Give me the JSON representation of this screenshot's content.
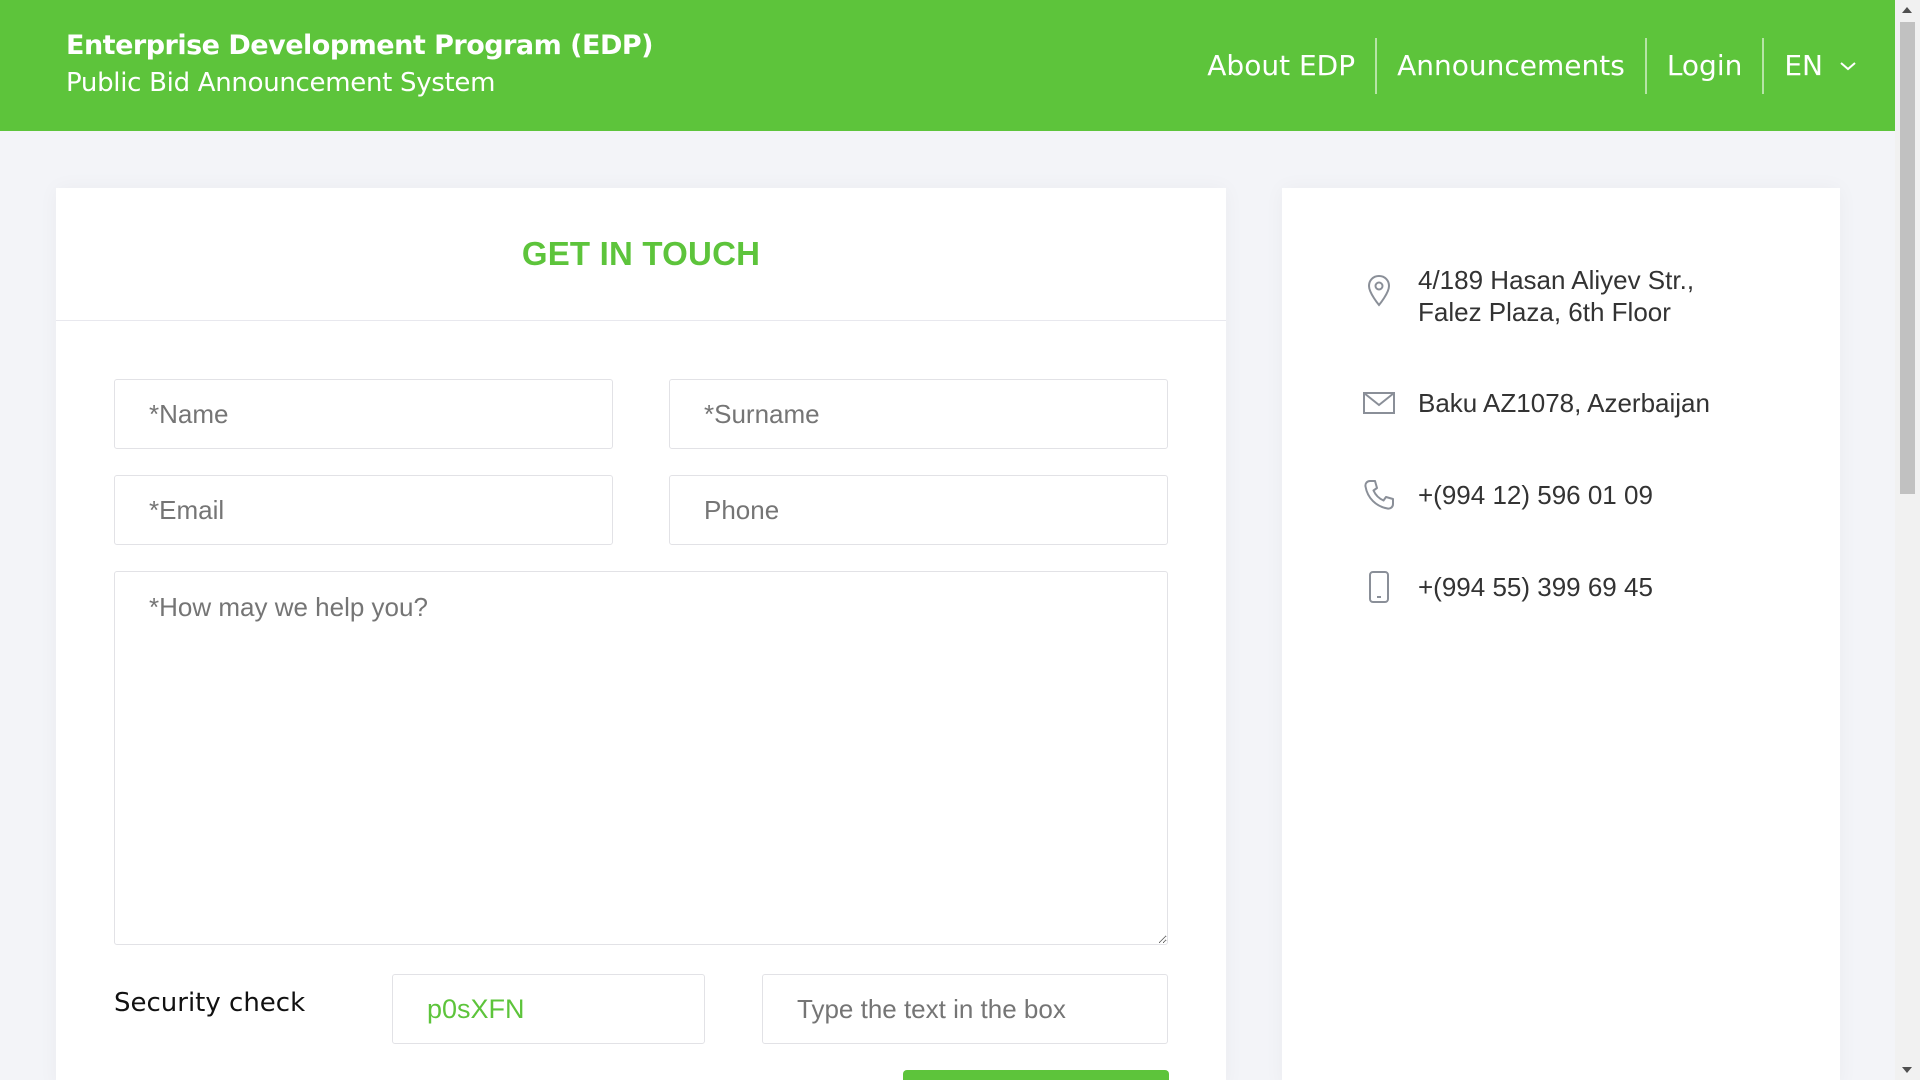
{
  "header": {
    "title": "Enterprise Development Program (EDP)",
    "subtitle": "Public Bid Announcement System",
    "nav": {
      "about": "About EDP",
      "announcements": "Announcements",
      "login": "Login",
      "language": "EN"
    }
  },
  "form": {
    "title": "GET IN TOUCH",
    "name_placeholder": "*Name",
    "surname_placeholder": "*Surname",
    "email_placeholder": "*Email",
    "phone_placeholder": "Phone",
    "message_placeholder": "*How may we help you?",
    "security_label": "Security check",
    "captcha_code": "p0sXFN",
    "captcha_placeholder": "Type the text in the box"
  },
  "contact": {
    "address_line1": "4/189 Hasan Aliyev Str.,",
    "address_line2": "Falez Plaza, 6th Floor",
    "city": "Baku AZ1078, Azerbaijan",
    "phone": "+(994 12) 596 01 09",
    "mobile": "+(994 55) 399 69 45"
  },
  "colors": {
    "brand": "#5dc43b",
    "icon": "#8a8f98"
  },
  "icons": [
    "chevron-down-icon",
    "location-pin-icon",
    "envelope-icon",
    "phone-icon",
    "mobile-phone-icon"
  ]
}
